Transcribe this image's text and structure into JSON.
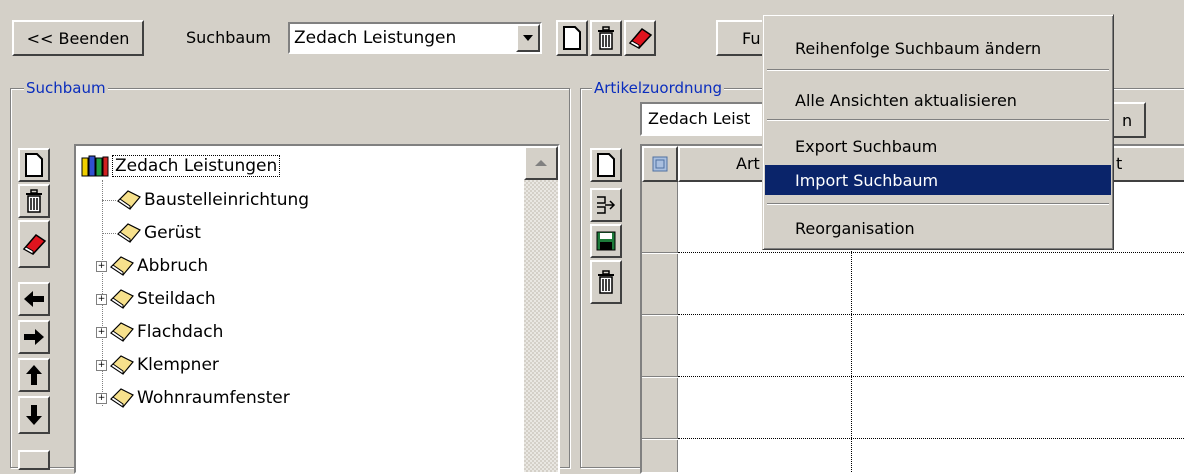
{
  "toolbar": {
    "exit_label": "<< Beenden",
    "search_tree_label": "Suchbaum",
    "search_tree_value": "Zedach Leistungen",
    "functions_label": "Fu"
  },
  "left_panel": {
    "legend": "Suchbaum",
    "tree": {
      "root": "Zedach Leistungen",
      "items": [
        {
          "label": "Baustelleinrichtung",
          "expandable": false
        },
        {
          "label": "Gerüst",
          "expandable": false
        },
        {
          "label": "Abbruch",
          "expandable": true
        },
        {
          "label": "Steildach",
          "expandable": true
        },
        {
          "label": "Flachdach",
          "expandable": true
        },
        {
          "label": "Klempner",
          "expandable": true
        },
        {
          "label": "Wohnraumfenster",
          "expandable": true
        }
      ]
    }
  },
  "right_panel": {
    "legend": "Artikelzuordnung",
    "selector_value": "Zedach Leist",
    "button_fragment": "n",
    "grid": {
      "header_art": "Art",
      "header_right": "t"
    }
  },
  "context_menu": {
    "items": [
      {
        "label": "Reihenfolge Suchbaum ändern",
        "highlighted": false
      },
      {
        "label": "Alle Ansichten aktualisieren",
        "highlighted": false
      },
      {
        "label": "Export Suchbaum",
        "highlighted": false
      },
      {
        "label": "Import Suchbaum",
        "highlighted": true
      },
      {
        "label": "Reorganisation",
        "highlighted": false
      }
    ],
    "highlight_color": "#0a246a"
  },
  "colors": {
    "window_bg": "#d4d0c8",
    "legend_text": "#0a2dbd",
    "selection_bg": "#0a246a",
    "eraser_red": "#e0141e",
    "floppy_green": "#1d7a3a"
  }
}
